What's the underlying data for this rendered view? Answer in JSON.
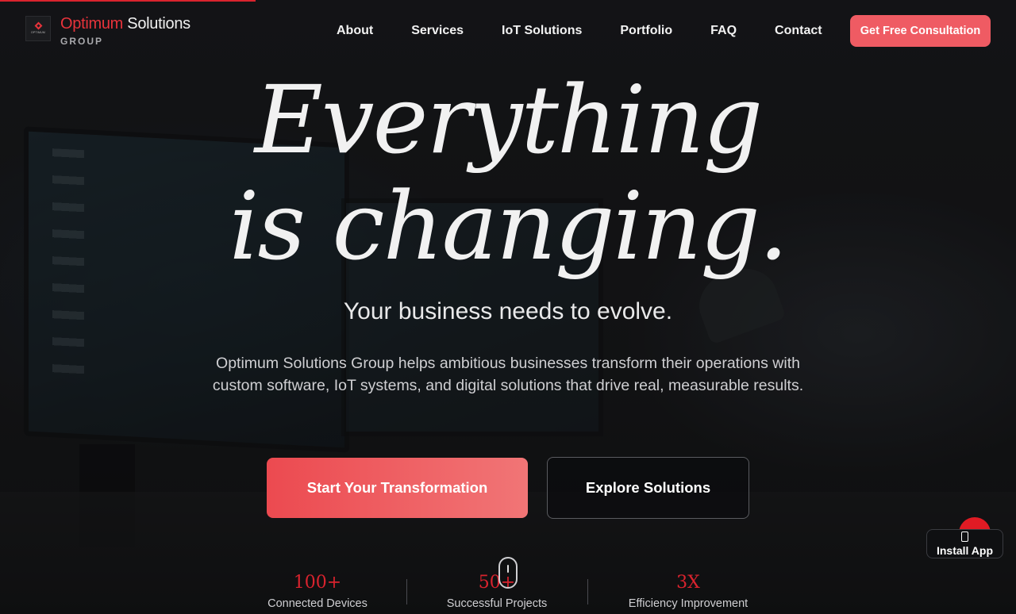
{
  "brand": {
    "name_accent": "Optimum",
    "name_rest": " Solutions",
    "tagline": "GROUP",
    "mark_text": "OPTIMUM",
    "accent_color": "#e8333b"
  },
  "nav": {
    "items": [
      {
        "label": "About"
      },
      {
        "label": "Services"
      },
      {
        "label": "IoT Solutions"
      },
      {
        "label": "Portfolio"
      },
      {
        "label": "FAQ"
      },
      {
        "label": "Contact"
      }
    ],
    "cta_label": "Get Free Consultation",
    "cta_color": "#ef5b63"
  },
  "hero": {
    "title_line1": "Everything",
    "title_line2": "is changing.",
    "subtitle": "Your business needs to evolve.",
    "description": "Optimum Solutions Group helps ambitious businesses transform their operations with custom software, IoT systems, and digital solutions that drive real, measurable results.",
    "primary_button": "Start Your Transformation",
    "secondary_button": "Explore Solutions"
  },
  "stats": [
    {
      "value": "100+",
      "label": "Connected Devices"
    },
    {
      "value": "50+",
      "label": "Successful Projects"
    },
    {
      "value": "3X",
      "label": "Efficiency Improvement"
    }
  ],
  "install": {
    "label": "Install App",
    "icon": "phone-icon"
  }
}
